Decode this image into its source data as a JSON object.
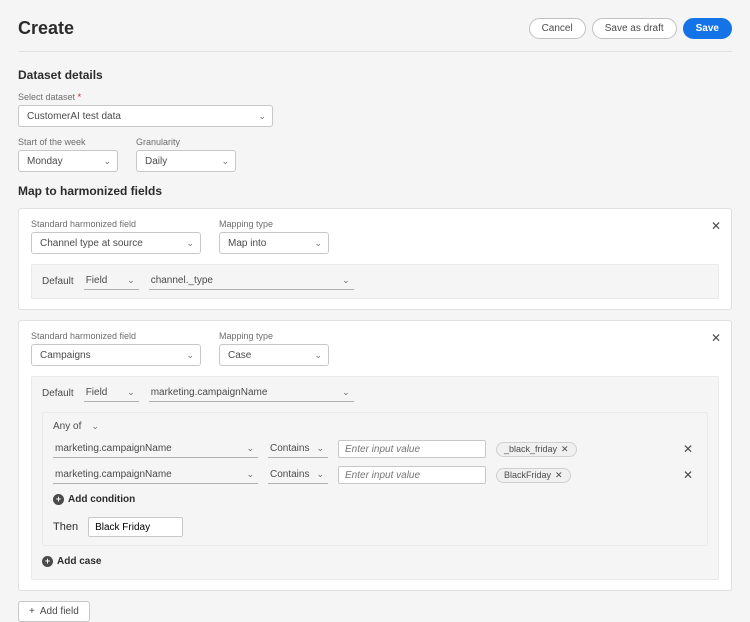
{
  "header": {
    "title": "Create",
    "buttons": {
      "cancel": "Cancel",
      "draft": "Save as draft",
      "save": "Save"
    }
  },
  "sections": {
    "datasetDetails": "Dataset details",
    "mapHarmonized": "Map to harmonized fields"
  },
  "dataset": {
    "selectLabel": "Select dataset",
    "selectValue": "CustomerAI test data",
    "weekLabel": "Start of the week",
    "weekValue": "Monday",
    "granularityLabel": "Granularity",
    "granularityValue": "Daily"
  },
  "mapping": {
    "stdFieldLabel": "Standard harmonized field",
    "mapTypeLabel": "Mapping type",
    "defaultLabel": "Default",
    "fieldLabel": "Field",
    "thenLabel": "Then",
    "anyOfLabel": "Any of",
    "containsLabel": "Contains",
    "inputPlaceholder": "Enter input value",
    "addConditionLabel": "Add condition",
    "addCaseLabel": "Add case",
    "addFieldLabel": "Add field"
  },
  "card1": {
    "stdField": "Channel type at source",
    "mapType": "Map into",
    "defaultField": "channel._type"
  },
  "card2": {
    "stdField": "Campaigns",
    "mapType": "Case",
    "defaultField": "marketing.campaignName",
    "rules": [
      {
        "field": "marketing.campaignName",
        "tag": "_black_friday"
      },
      {
        "field": "marketing.campaignName",
        "tag": "BlackFriday"
      }
    ],
    "thenValue": "Black Friday"
  }
}
